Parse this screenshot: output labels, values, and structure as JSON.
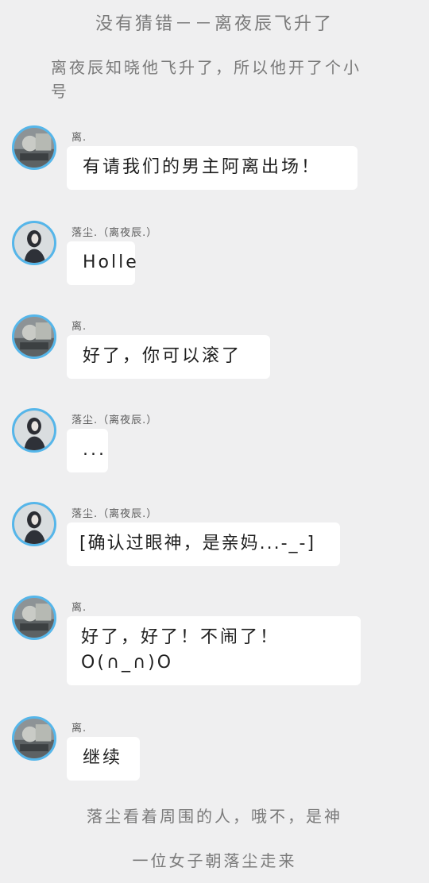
{
  "title": "没有猜错－－离夜辰飞升了",
  "intro": "离夜辰知晓他飞升了，所以他开了个小号",
  "messages": [
    {
      "sender": "离.",
      "avatar": "avatar-li",
      "text": "有请我们的男主阿离出场！"
    },
    {
      "sender": "落尘.（离夜辰.）",
      "avatar": "avatar-luochen",
      "text": "Holle"
    },
    {
      "sender": "离.",
      "avatar": "avatar-li",
      "text": "好了，你可以滚了"
    },
    {
      "sender": "落尘.（离夜辰.）",
      "avatar": "avatar-luochen",
      "text": "..."
    },
    {
      "sender": "落尘.（离夜辰.）",
      "avatar": "avatar-luochen",
      "text": "[确认过眼神，是亲妈...-_-]"
    },
    {
      "sender": "离.",
      "avatar": "avatar-li",
      "text": "好了，好了！不闹了！\nO(∩_∩)O"
    },
    {
      "sender": "离.",
      "avatar": "avatar-li",
      "text": "继续"
    }
  ],
  "narration": [
    "落尘看着周围的人，哦不，是神",
    "一位女子朝落尘走来"
  ],
  "colors": {
    "background": "#efeff0",
    "bubble": "#ffffff",
    "avatar_ring": "#55b6ea",
    "narration_text": "#7a7a7a"
  }
}
